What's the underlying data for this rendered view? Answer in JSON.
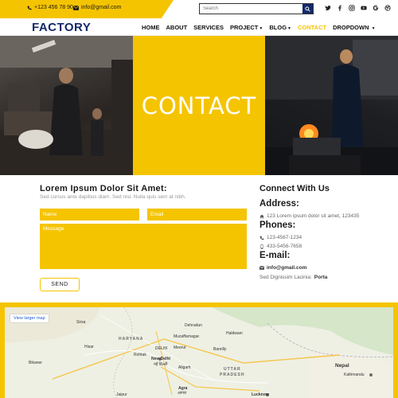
{
  "topbar": {
    "phone": "+123 456 78 90",
    "email": "info@gmail.com",
    "search_placeholder": "Search",
    "social_icons": [
      "twitter-icon",
      "facebook-icon",
      "instagram-icon",
      "youtube-icon",
      "google-icon",
      "dribbble-icon"
    ]
  },
  "navbar": {
    "brand": "FACTORY",
    "items": [
      {
        "label": "HOME"
      },
      {
        "label": "ABOUT"
      },
      {
        "label": "SERVICES"
      },
      {
        "label": "PROJECT"
      },
      {
        "label": "BLOG"
      },
      {
        "label": "CONTACT"
      },
      {
        "label": "DROPDOWN"
      }
    ]
  },
  "hero": {
    "title": "CONTACT"
  },
  "form": {
    "heading": "Lorem Ipsum Dolor Sit Amet:",
    "subtext": "Sed cursus ante dapibus diam. Sed nisi. Nulla quis sem at nibh.",
    "name_placeholder": "Name",
    "email_placeholder": "Email",
    "message_placeholder": "Message",
    "send_label": "SEND"
  },
  "sidebar": {
    "connect_heading": "Connect With Us",
    "address_heading": "Address:",
    "address_text": "123 Lorem ipsum dolor sit amet, 123435",
    "phones_heading": "Phones:",
    "phone1": "123-4567-1234",
    "phone2": "433-5456-7658",
    "email_heading": "E-mail:",
    "email_text": "info@gmail.com",
    "extra_prefix": "Sed Dignissim Lacinia:",
    "extra_value": "Porta"
  },
  "map": {
    "view_larger": "View larger map",
    "labels": [
      "HARYANA",
      "DELHI",
      "New Delhi",
      "नई दिल्ली",
      "UTTAR",
      "PRADESH",
      "Nepal",
      "Kathmandu",
      "Lucknow",
      "Agra",
      "आगरा",
      "Jaipur",
      "Bikaner",
      "Dehradun",
      "Aligarh",
      "Bareilly",
      "Sirsa",
      "Hisar",
      "Rohtak",
      "Meerut",
      "Haldwani",
      "Muzaffarnagar"
    ]
  },
  "colors": {
    "accent": "#f5c400",
    "brand": "#13296b"
  }
}
